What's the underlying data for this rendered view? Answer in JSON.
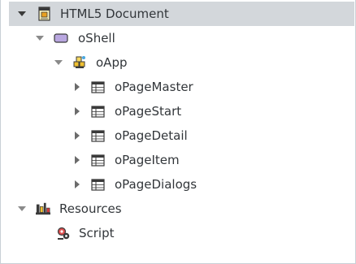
{
  "tree": {
    "nodes": [
      {
        "label": "HTML5 Document",
        "icon": "document-icon",
        "expanded": true,
        "selected": true
      },
      {
        "label": "oShell",
        "icon": "shell-icon",
        "expanded": true
      },
      {
        "label": "oApp",
        "icon": "app-cubes-icon",
        "expanded": true
      },
      {
        "label": "oPageMaster",
        "icon": "page-table-icon",
        "expanded": false
      },
      {
        "label": "oPageStart",
        "icon": "page-table-icon",
        "expanded": false
      },
      {
        "label": "oPageDetail",
        "icon": "page-table-icon",
        "expanded": false
      },
      {
        "label": "oPageItem",
        "icon": "page-table-icon",
        "expanded": false
      },
      {
        "label": "oPageDialogs",
        "icon": "page-table-icon",
        "expanded": false
      },
      {
        "label": "Resources",
        "icon": "resources-icon",
        "expanded": true
      },
      {
        "label": "Script",
        "icon": "script-gear-icon",
        "expanded": null
      }
    ]
  },
  "colors": {
    "selection": "#d3d7db",
    "text": "#32363a",
    "border": "#c9d0d6"
  }
}
